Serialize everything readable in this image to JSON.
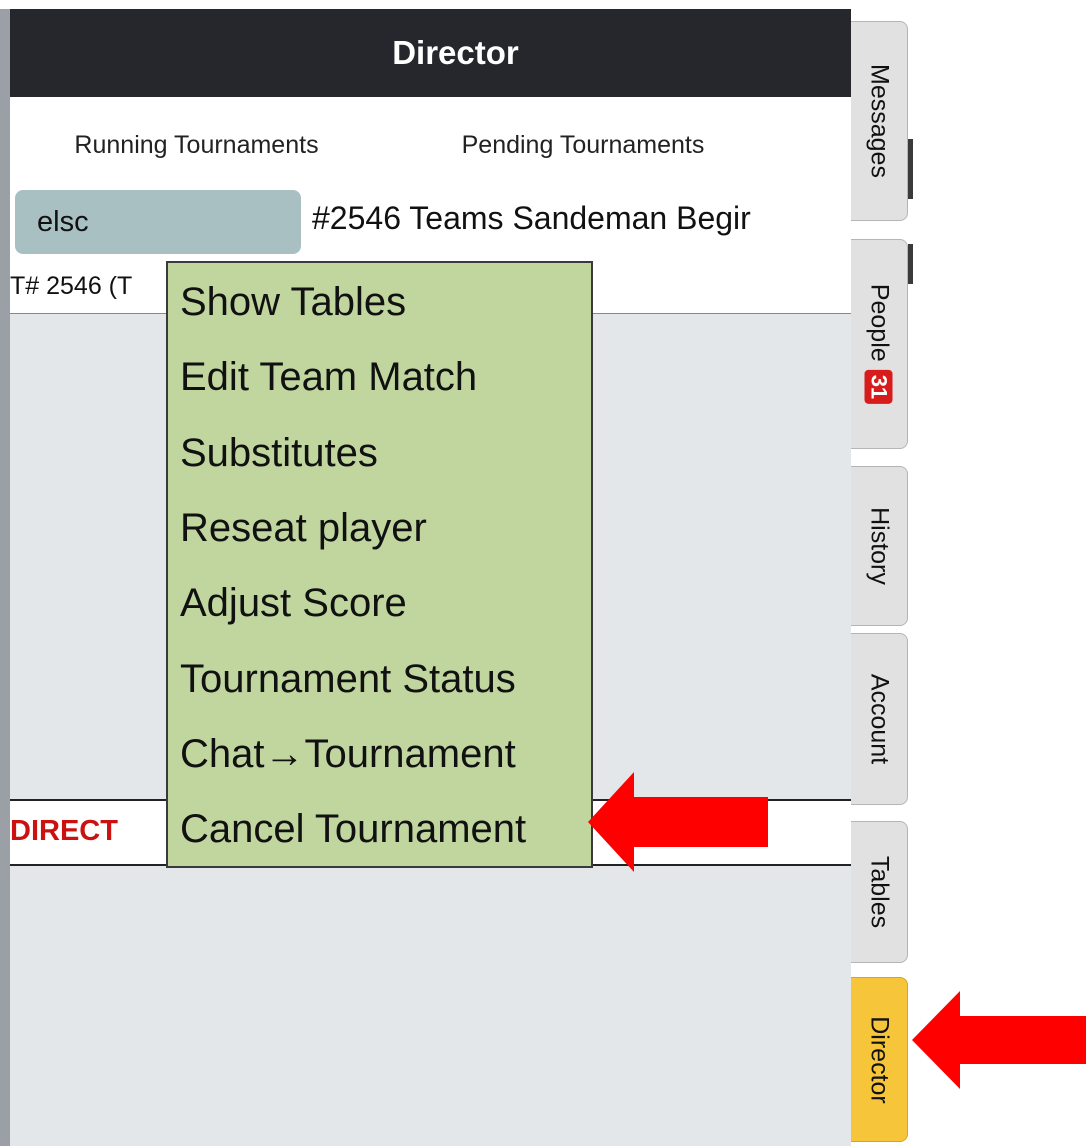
{
  "header": {
    "title": "Director"
  },
  "tabs": [
    {
      "label": "Running Tournaments",
      "active": true
    },
    {
      "label": "Pending Tournaments",
      "active": false
    }
  ],
  "tournament_row": {
    "director": "elsc",
    "title": "#2546 Teams Sandeman Begir",
    "id_text": "T# 2546 (T"
  },
  "director_row": {
    "label": "DIRECT"
  },
  "menu": {
    "items": [
      "Show Tables",
      "Edit Team Match",
      "Substitutes",
      "Reseat player",
      "Adjust Score",
      "Tournament Status",
      "Chat→Tournament",
      "Cancel Tournament"
    ]
  },
  "sidebar": {
    "tabs": [
      {
        "label": "Messages"
      },
      {
        "label": "People",
        "badge": "31"
      },
      {
        "label": "History"
      },
      {
        "label": "Account"
      },
      {
        "label": "Tables"
      },
      {
        "label": "Director",
        "active": true
      }
    ]
  },
  "colors": {
    "header_bg": "#25272c",
    "menu_bg": "#c1d69f",
    "active_tab_bg": "#f6c53a",
    "tab_underline": "#7a4fc4",
    "director_text": "#cc1111",
    "badge_bg": "#d81b1b",
    "arrow": "#ff0000"
  }
}
